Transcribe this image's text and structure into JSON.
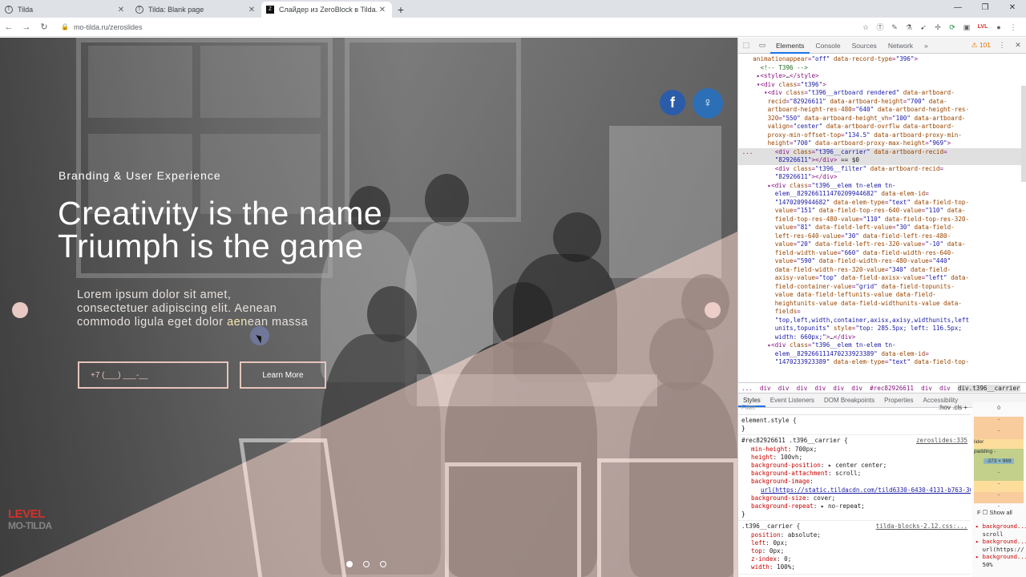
{
  "browser": {
    "tabs": [
      {
        "title": "Tilda",
        "icon": "tilda",
        "active": false
      },
      {
        "title": "Tilda: Blank page",
        "icon": "tilda",
        "active": false
      },
      {
        "title": "Слайдер из ZeroBlock в Tilda.cc",
        "icon": "zb",
        "active": true
      }
    ],
    "url": "mo-tilda.ru/zeroslides"
  },
  "page": {
    "subtitle": "Branding & User Experience",
    "headline_line1": "Creativity is the name",
    "headline_line2": "Triumph is the game",
    "lorem_line1": "Lorem ipsum dolor sit amet,",
    "lorem_line2": "consectetuer adipiscing elit. Aenean",
    "lorem_line3_a": "commodo ligula eget dolor ",
    "lorem_line3_hl": "aen",
    "lorem_line3_b": "ean massa",
    "phone_placeholder": "+7 (___) ___-__",
    "learn_more": "Learn More",
    "logo_top": "LEVEL",
    "logo_bottom": "MO-TILDA",
    "social_fb": "f",
    "social_runner": "♀",
    "accent_color": "#e7c4bc",
    "overlay_color": "#f2cfc7"
  },
  "devtools": {
    "tabs": [
      "Elements",
      "Console",
      "Sources",
      "Network"
    ],
    "more": "»",
    "warnings": "101",
    "breadcrumb": [
      "...",
      "div",
      "div",
      "div",
      "div",
      "div",
      "div",
      "#rec82926611",
      "div",
      "div"
    ],
    "breadcrumb_current": "div.t396__carrier",
    "sub_tabs": [
      "Styles",
      "Event Listeners",
      "DOM Breakpoints",
      "Properties",
      "Accessibility"
    ],
    "filter_placeholder": "Filter",
    "filter_opts": ":hov  .cls  +",
    "element_style": "element.style {",
    "rule1_selector": "#rec82926611 .t396__carrier {",
    "rule1_source": "zeroslides:335",
    "rule1_props": [
      [
        "min-height",
        "700px;"
      ],
      [
        "height",
        "100vh;"
      ],
      [
        "background-position",
        "▸ center center;"
      ],
      [
        "background-attachment",
        "scroll;"
      ],
      [
        "background-image",
        ""
      ],
      [
        "",
        "url(https://static.tildacdn.com/tild6330-6430-4131-b763-363533626639/h1-slide-1.jpg);"
      ],
      [
        "background-size",
        "cover;"
      ],
      [
        "background-repeat",
        "▸ no-repeat;"
      ]
    ],
    "rule2_selector": ".t396__carrier {",
    "rule2_source": "tilda-blocks-2.12.css:...",
    "rule2_props": [
      [
        "position",
        "absolute;"
      ],
      [
        "left",
        "0px;"
      ],
      [
        "top",
        "0px;"
      ],
      [
        "z-index",
        "0;"
      ],
      [
        "width",
        "100%;"
      ]
    ],
    "box_values": [
      "0",
      "-",
      "-",
      "lider",
      "padding -",
      "-373 × 969",
      "-",
      "-",
      "-",
      "-"
    ],
    "show_all": "Show all",
    "computed": [
      "background...",
      "scroll",
      "background...",
      "url(https://",
      "background...",
      "50%"
    ]
  }
}
